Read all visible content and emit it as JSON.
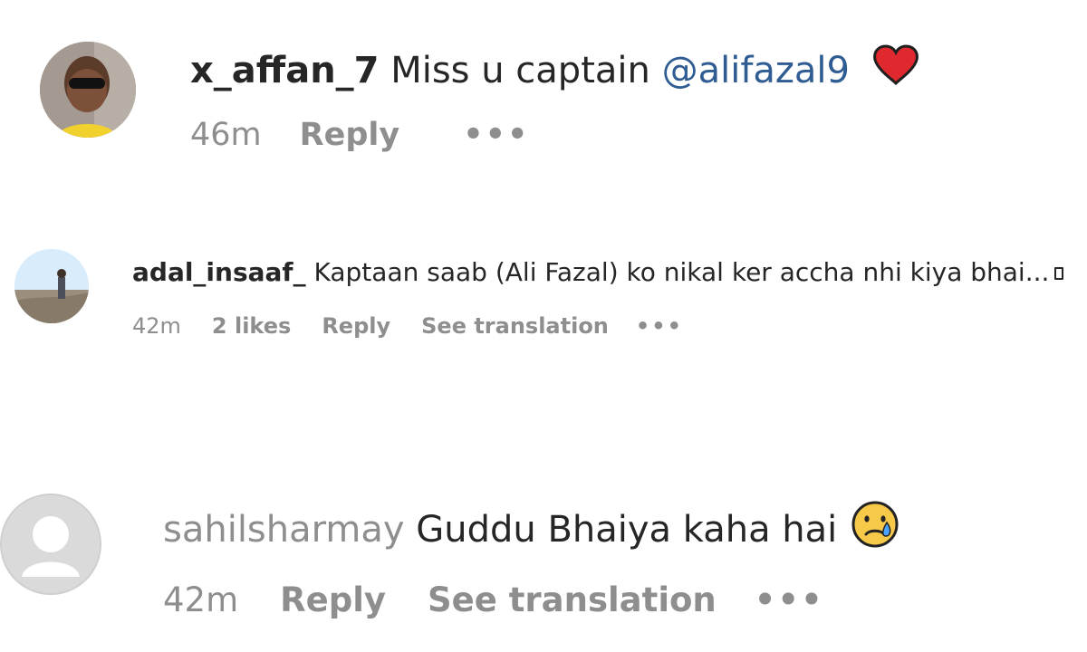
{
  "comments": [
    {
      "username": "x_affan_7",
      "text": " Miss u captain ",
      "mention": "@alifazal9",
      "emoji": "red-heart",
      "time": "46m",
      "reply": "Reply",
      "more": "•••"
    },
    {
      "username": "adal_insaaf_",
      "text": " Kaptaan saab (Ali Fazal) ko nikal ker accha nhi kiya bhai...",
      "time": "42m",
      "likes": "2 likes",
      "reply": "Reply",
      "translate": "See translation",
      "more": "•••"
    },
    {
      "username": "sahilsharmay",
      "text": " Guddu Bhaiya kaha hai",
      "emoji": "crying-face",
      "time": "42m",
      "reply": "Reply",
      "translate": "See translation",
      "more": "•••"
    }
  ],
  "colors": {
    "text": "#262626",
    "meta": "#8e8e8e",
    "mention": "#2f5d93",
    "heart": "#e0282f",
    "emoji_face": "#f7c948"
  }
}
